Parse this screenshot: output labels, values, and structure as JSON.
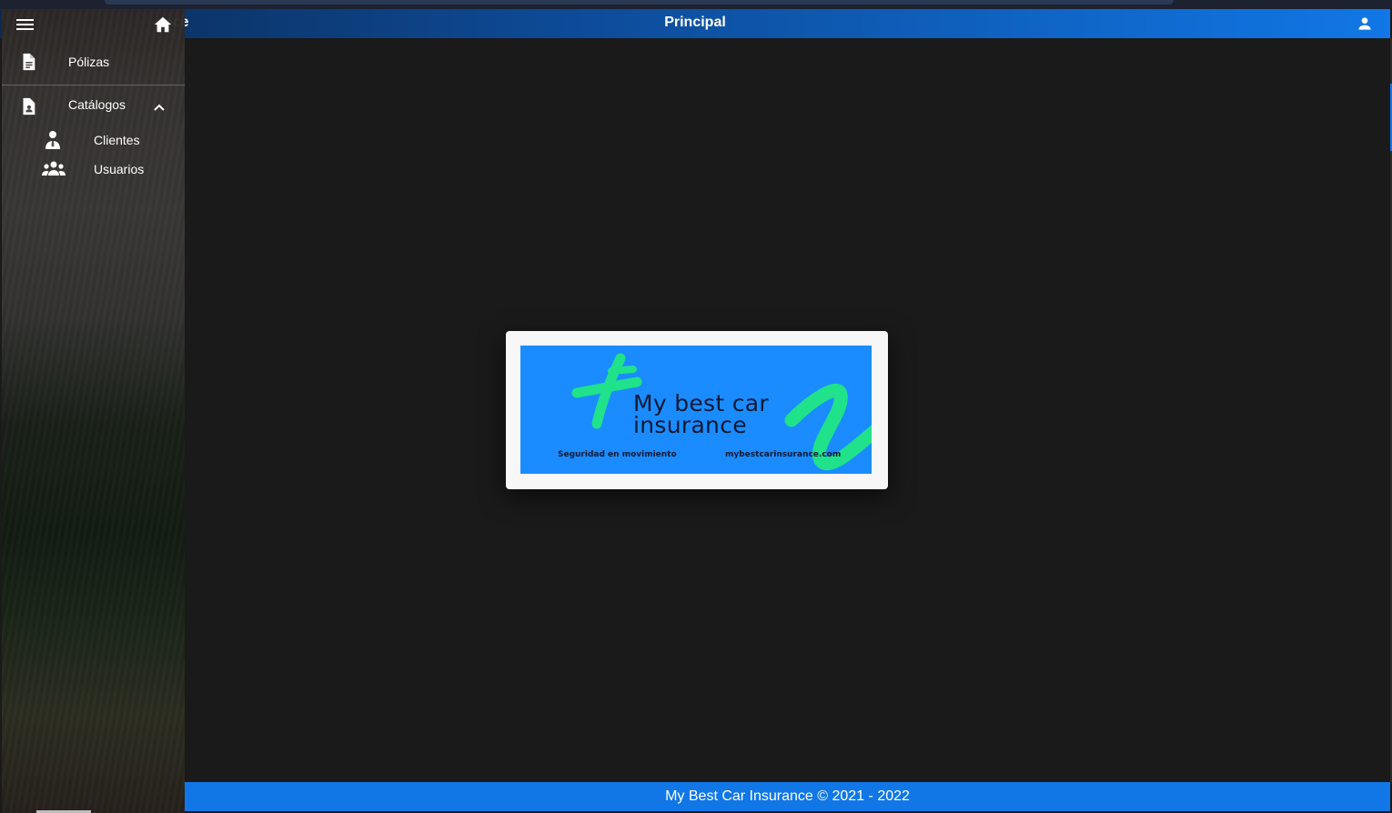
{
  "appbar": {
    "title_fragment": "nce",
    "title": "Principal",
    "user_icon": "account-icon"
  },
  "sidebar": {
    "menu_icon": "menu-icon",
    "home_icon": "home-icon",
    "items": [
      {
        "label": "Pólizas",
        "icon": "file-document-icon"
      },
      {
        "label": "Catálogos",
        "icon": "account-box-file-icon",
        "expanded": true,
        "children": [
          {
            "label": "Clientes",
            "icon": "account-tie-icon"
          },
          {
            "label": "Usuarios",
            "icon": "account-group-icon"
          }
        ]
      }
    ]
  },
  "logo": {
    "name_line1": "My best car",
    "name_line2": "insurance",
    "tagline": "Seguridad en movimiento",
    "url": "mybestcarinsurance.com",
    "colors": {
      "banner": "#1a8cff",
      "accent": "#1fe28a",
      "text": "#0b1830"
    }
  },
  "footer": {
    "text": "My Best Car Insurance © 2021 - 2022"
  },
  "colors": {
    "appbar_start": "#0c2a52",
    "appbar_end": "#1177e6",
    "footer": "#1177e6",
    "background": "#1a1a1a"
  }
}
